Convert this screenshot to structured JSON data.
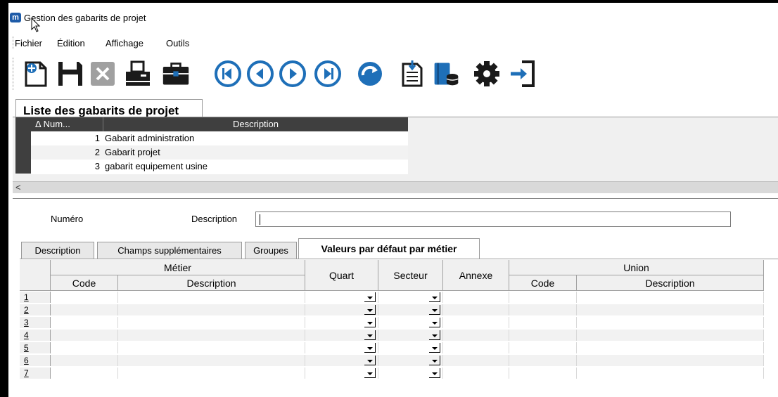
{
  "window": {
    "title": "Gestion des gabarits de projet",
    "app_icon_letter": "m"
  },
  "menu": {
    "items": [
      "Fichier",
      "Édition",
      "Affichage",
      "Outils"
    ]
  },
  "toolbar": {
    "buttons": [
      "new-icon",
      "save-icon",
      "delete-icon",
      "print-icon",
      "briefcase-icon",
      "first-record-icon",
      "previous-record-icon",
      "next-record-icon",
      "last-record-icon",
      "refresh-icon",
      "import-document-icon",
      "database-icon",
      "settings-icon",
      "exit-icon"
    ],
    "accent_color": "#1e6fb8"
  },
  "list": {
    "tab_label": "Liste des gabarits de projet",
    "columns": [
      "Δ Num...",
      "Description"
    ],
    "rows": [
      {
        "num": "1",
        "description": "Gabarit administration"
      },
      {
        "num": "2",
        "description": "Gabarit projet"
      },
      {
        "num": "3",
        "description": "gabarit equipement usine"
      }
    ],
    "scroll_left": "<"
  },
  "form": {
    "numero_label": "Numéro",
    "description_label": "Description",
    "description_value": ""
  },
  "tabs": [
    {
      "label": "Description",
      "active": false
    },
    {
      "label": "Champs supplémentaires",
      "active": false
    },
    {
      "label": "Groupes",
      "active": false
    },
    {
      "label": "Valeurs par défaut par métier",
      "active": true
    }
  ],
  "grid": {
    "group_metier": "Métier",
    "col_code": "Code",
    "col_description": "Description",
    "col_quart": "Quart",
    "col_secteur": "Secteur",
    "col_annexe": "Annexe",
    "group_union": "Union",
    "union_code": "Code",
    "union_description": "Description",
    "row_numbers": [
      "1",
      "2",
      "3",
      "4",
      "5",
      "6",
      "7"
    ]
  }
}
